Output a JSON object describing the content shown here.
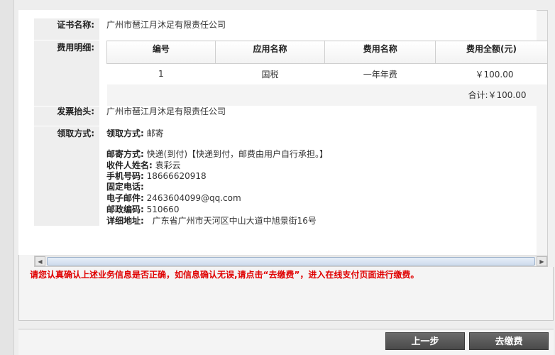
{
  "certificate": {
    "label": "证书名称:",
    "value": "广州市琶江月沐足有限责任公司"
  },
  "fee_details": {
    "label": "费用明细:",
    "columns": [
      "编号",
      "应用名称",
      "费用名称",
      "费用全额(元)"
    ],
    "rows": [
      {
        "no": "1",
        "app": "国税",
        "fee_name": "一年年费",
        "amount": "￥100.00"
      }
    ],
    "total": "合计:￥100.00"
  },
  "invoice": {
    "label": "发票抬头:",
    "value": "广州市琶江月沐足有限责任公司"
  },
  "pickup": {
    "label": "领取方式:",
    "method_label": "领取方式:",
    "method_value": "邮寄",
    "mail_label": "邮寄方式:",
    "mail_value": "快递(到付)【快递到付，邮费由用户自行承担。】",
    "recipient_label": "收件人姓名:",
    "recipient_value": "袁彩云",
    "mobile_label": "手机号码:",
    "mobile_value": "18666620918",
    "phone_label": "固定电话:",
    "phone_value": "",
    "email_label": "电子邮件:",
    "email_value": "2463604099@qq.com",
    "postcode_label": "邮政编码:",
    "postcode_value": "510660",
    "address_label": "详细地址:",
    "address_value": "广东省广州市天河区中山大道中旭景街16号"
  },
  "warning": "请您认真确认上述业务信息是否正确，如信息确认无误,请点击“去缴费”，进入在线支付页面进行缴费。",
  "buttons": {
    "prev": "上一步",
    "pay": "去缴费"
  }
}
